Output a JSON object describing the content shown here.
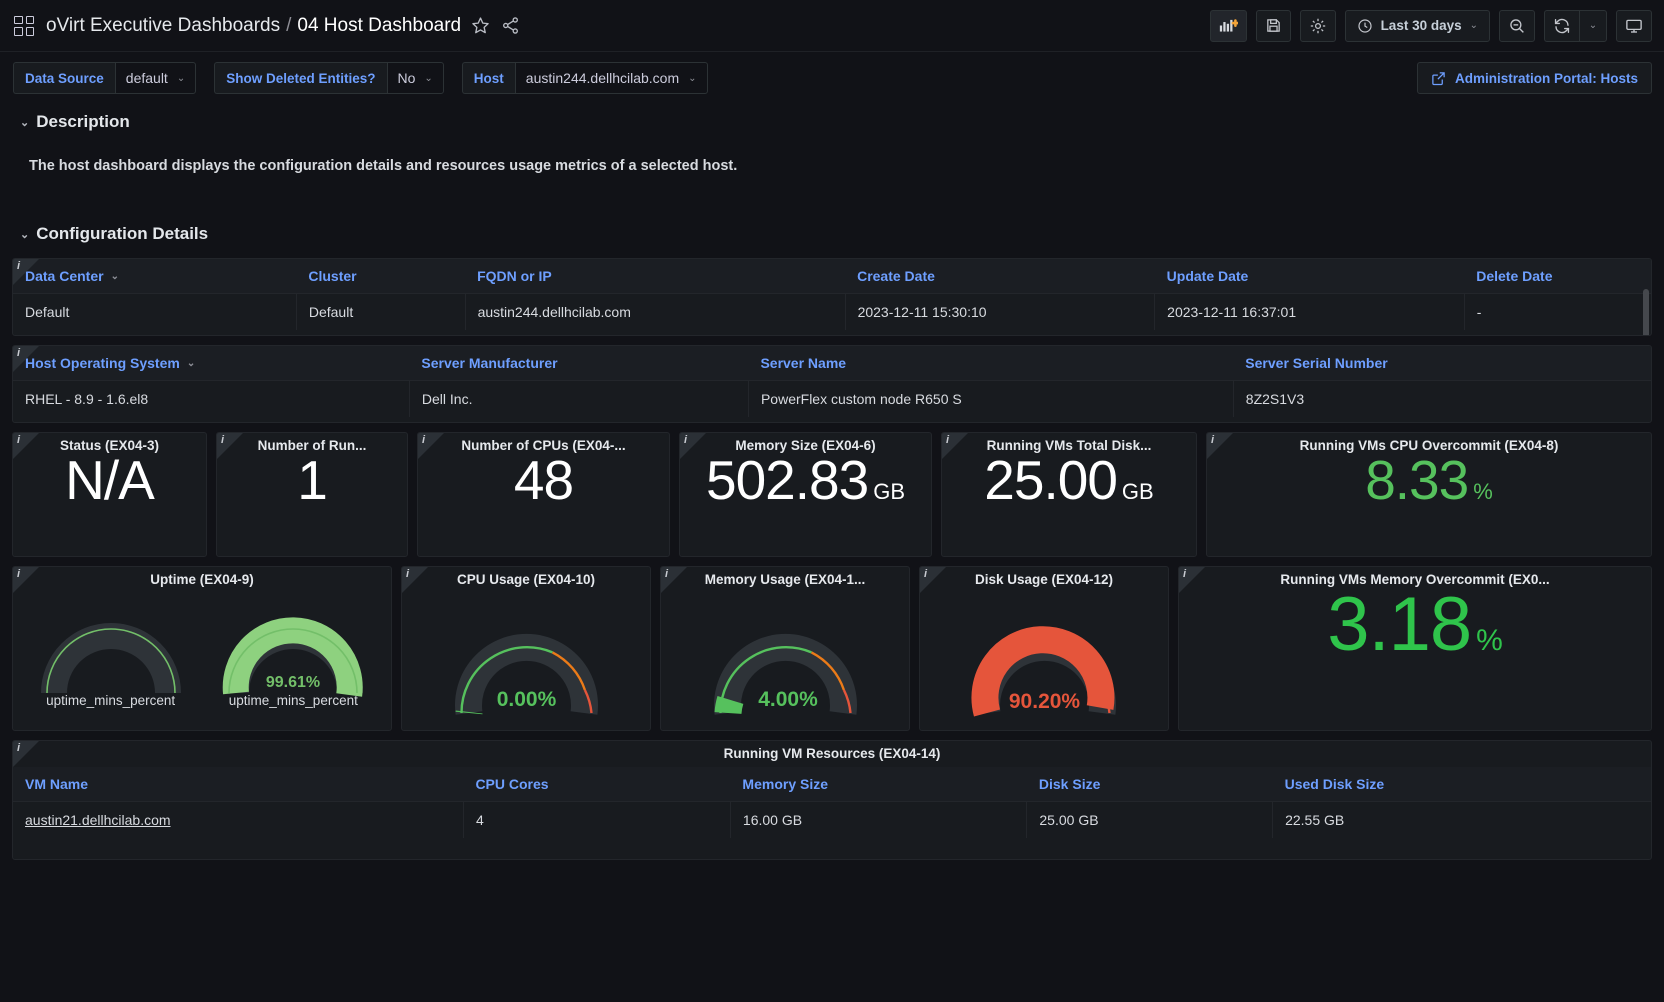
{
  "topnav": {
    "grid_icon": "dashboards-grid-icon",
    "breadcrumb_root": "oVirt Executive Dashboards",
    "breadcrumb_sep": "/",
    "breadcrumb_current": "04 Host Dashboard",
    "star_icon": "star-icon",
    "share_icon": "share-icon",
    "add_panel_icon": "add-panel-icon",
    "save_icon": "save-dashboard-icon",
    "settings_icon": "dashboard-settings-icon",
    "clock_icon": "clock-icon",
    "time_range": "Last 30 days",
    "time_caret": "⌄",
    "zoom_out_icon": "zoom-out-icon",
    "refresh_icon": "refresh-icon",
    "refresh_caret": "⌄",
    "tv_icon": "tv-mode-icon"
  },
  "variables": [
    {
      "label": "Data Source",
      "value": "default",
      "name": "datasource"
    },
    {
      "label": "Show Deleted Entities?",
      "value": "No",
      "name": "show-deleted"
    },
    {
      "label": "Host",
      "value": "austin244.dellhcilab.com",
      "name": "host"
    }
  ],
  "admin_button": {
    "label": "Administration Portal: Hosts",
    "icon": "external-link-icon"
  },
  "sections": {
    "description": {
      "title": "Description",
      "chevron": "⌄",
      "text": "The host dashboard displays the configuration details and resources usage metrics of a selected host."
    },
    "configuration": {
      "title": "Configuration Details",
      "chevron": "⌄"
    }
  },
  "config_table_1": {
    "headers": [
      "Data Center",
      "Cluster",
      "FQDN or IP",
      "Create Date",
      "Update Date",
      "Delete Date"
    ],
    "sort_caret": "⌄",
    "rows": [
      [
        "Default",
        "Default",
        "austin244.dellhcilab.com",
        "2023-12-11 15:30:10",
        "2023-12-11 16:37:01",
        "-"
      ]
    ]
  },
  "config_table_2": {
    "headers": [
      "Host Operating System",
      "Server Manufacturer",
      "Server Name",
      "Server Serial Number"
    ],
    "sort_caret": "⌄",
    "rows": [
      [
        "RHEL - 8.9 - 1.6.el8",
        "Dell Inc.",
        "PowerFlex custom node R650 S",
        "8Z2S1V3"
      ]
    ]
  },
  "stats": [
    {
      "title": "Status (EX04-3)",
      "value": "N/A",
      "unit": "",
      "color": "#ffffff"
    },
    {
      "title": "Number of Run...",
      "value": "1",
      "unit": "",
      "color": "#ffffff"
    },
    {
      "title": "Number of CPUs (EX04-...",
      "value": "48",
      "unit": "",
      "color": "#ffffff"
    },
    {
      "title": "Memory Size (EX04-6)",
      "value": "502.83",
      "unit": "GB",
      "color": "#ffffff"
    },
    {
      "title": "Running VMs Total Disk...",
      "value": "25.00",
      "unit": "GB",
      "color": "#ffffff"
    },
    {
      "title": "Running VMs CPU Overcommit (EX04-8)",
      "value": "8.33",
      "unit": "%",
      "color": "#56c15d"
    }
  ],
  "gauges_panel_uptime": {
    "title": "Uptime (EX04-9)",
    "items": [
      {
        "label": "uptime_mins_percent",
        "value": "",
        "percent": 0,
        "color": "#73bf69",
        "show_value": false
      },
      {
        "label": "uptime_mins_percent",
        "value": "99.61%",
        "percent": 99.61,
        "color": "#73bf69",
        "show_value": true
      }
    ]
  },
  "gauges": [
    {
      "title": "CPU Usage (EX04-10)",
      "value": "0.00%",
      "percent": 0,
      "color": "#56c15d",
      "name": "cpu-usage"
    },
    {
      "title": "Memory Usage (EX04-1...",
      "value": "4.00%",
      "percent": 4,
      "color": "#56c15d",
      "name": "memory-usage"
    },
    {
      "title": "Disk Usage (EX04-12)",
      "value": "90.20%",
      "percent": 90.2,
      "color": "#e5553b",
      "name": "disk-usage"
    }
  ],
  "stat_mem_overcommit": {
    "title": "Running VMs Memory Overcommit (EX0...",
    "value": "3.18",
    "unit": "%",
    "color": "#56c15d"
  },
  "vm_table": {
    "panel_title": "Running VM Resources (EX04-14)",
    "headers": [
      "VM Name",
      "CPU Cores",
      "Memory Size",
      "Disk Size",
      "Used Disk Size"
    ],
    "rows": [
      [
        "austin21.dellhcilab.com",
        "4",
        "16.00 GB",
        "25.00 GB",
        "22.55 GB"
      ]
    ]
  },
  "chart_data": {
    "type": "gauge",
    "title": "Host resource usage gauges",
    "ylim": [
      0,
      100
    ],
    "series": [
      {
        "name": "Uptime (EX04-9) / uptime_mins_percent #1",
        "value": 0,
        "unit": "%",
        "display": ""
      },
      {
        "name": "Uptime (EX04-9) / uptime_mins_percent #2",
        "value": 99.61,
        "unit": "%",
        "display": "99.61%"
      },
      {
        "name": "CPU Usage (EX04-10)",
        "value": 0.0,
        "unit": "%",
        "display": "0.00%"
      },
      {
        "name": "Memory Usage (EX04-11)",
        "value": 4.0,
        "unit": "%",
        "display": "4.00%"
      },
      {
        "name": "Disk Usage (EX04-12)",
        "value": 90.2,
        "unit": "%",
        "display": "90.20%"
      }
    ],
    "thresholds": [
      {
        "from": 0,
        "to": 70,
        "color": "#56c15d"
      },
      {
        "from": 70,
        "to": 85,
        "color": "#eb7b18"
      },
      {
        "from": 85,
        "to": 100,
        "color": "#e5553b"
      }
    ],
    "stat_values": [
      {
        "name": "Number of Running VMs",
        "value": 1
      },
      {
        "name": "Number of CPUs",
        "value": 48
      },
      {
        "name": "Memory Size",
        "value": 502.83,
        "unit": "GB"
      },
      {
        "name": "Running VMs Total Disk Size",
        "value": 25.0,
        "unit": "GB"
      },
      {
        "name": "Running VMs CPU Overcommit",
        "value": 8.33,
        "unit": "%"
      },
      {
        "name": "Running VMs Memory Overcommit",
        "value": 3.18,
        "unit": "%"
      }
    ]
  }
}
